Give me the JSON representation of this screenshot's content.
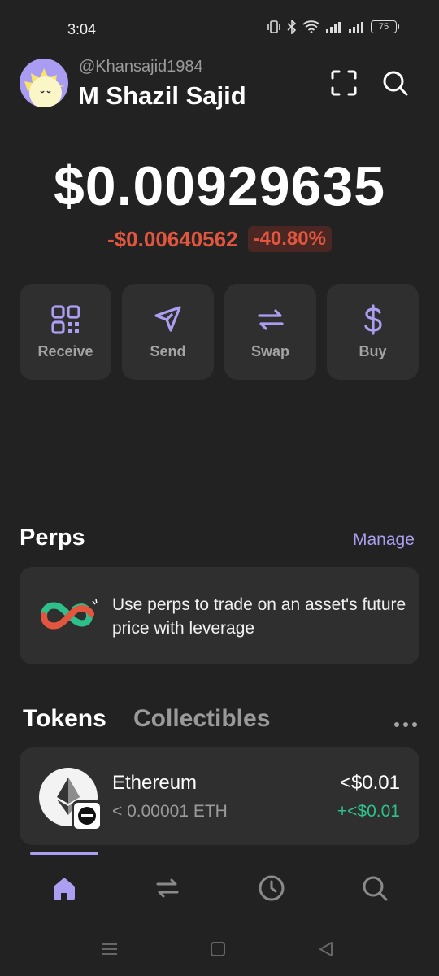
{
  "status_bar": {
    "time": "3:04",
    "battery": "75",
    "icons": [
      "vibrate-icon",
      "bluetooth-icon",
      "wifi-icon",
      "signal-icon",
      "signal-icon"
    ]
  },
  "header": {
    "handle": "@Khansajid1984",
    "name": "M Shazil Sajid",
    "icons": [
      "scan-icon",
      "search-icon"
    ]
  },
  "balance": {
    "amount": "$0.00929635",
    "change_amount": "-$0.00640562",
    "change_percent": "-40.80%",
    "change_color": "#e2553e"
  },
  "actions": [
    {
      "label": "Receive",
      "icon": "qr-code-icon"
    },
    {
      "label": "Send",
      "icon": "send-icon"
    },
    {
      "label": "Swap",
      "icon": "swap-icon"
    },
    {
      "label": "Buy",
      "icon": "dollar-icon"
    }
  ],
  "perps": {
    "title": "Perps",
    "manage_label": "Manage",
    "promo_text": "Use perps to trade on an asset's future price with leverage"
  },
  "tokens": {
    "tabs": [
      "Tokens",
      "Collectibles"
    ],
    "items": [
      {
        "name": "Ethereum",
        "amount": "< 0.00001 ETH",
        "value": "<$0.01",
        "change": "+<$0.01"
      }
    ]
  },
  "nav": {
    "items": [
      "home-icon",
      "swap-icon",
      "history-icon",
      "search-icon"
    ],
    "active": "home-icon"
  },
  "colors": {
    "background": "#222222",
    "card": "#2f2f2f",
    "accent": "#ab9ff2",
    "negative": "#e2553e",
    "positive": "#2ec08b"
  }
}
